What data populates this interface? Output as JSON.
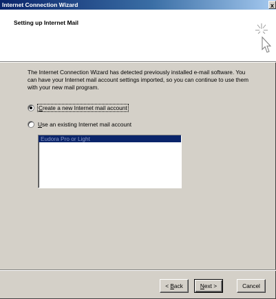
{
  "window": {
    "title": "Internet Connection Wizard",
    "close_label": "x"
  },
  "header": {
    "title": "Setting up Internet Mail",
    "icon": "wizard-cursor-icon"
  },
  "intro": {
    "text": "The Internet Connection Wizard has detected previously installed e-mail software. You can have your Internet mail account settings imported, so you can continue to use them with your new mail program."
  },
  "options": {
    "create_new": {
      "access_key": "C",
      "rest": "reate a new Internet mail account",
      "selected": true
    },
    "use_existing": {
      "access_key": "U",
      "rest": "se an existing Internet mail account",
      "selected": false
    }
  },
  "mail_programs": {
    "items": [
      "Eudora Pro or Light"
    ],
    "selected_index": 0
  },
  "buttons": {
    "back": {
      "prefix": "< ",
      "access_key": "B",
      "rest": "ack"
    },
    "next": {
      "prefix": "",
      "access_key": "N",
      "rest": "ext >"
    },
    "cancel": {
      "label": "Cancel"
    }
  },
  "colors": {
    "title_bar": "#0a246a",
    "dialog_face": "#d4d0c8",
    "selection": "#0a246a"
  }
}
